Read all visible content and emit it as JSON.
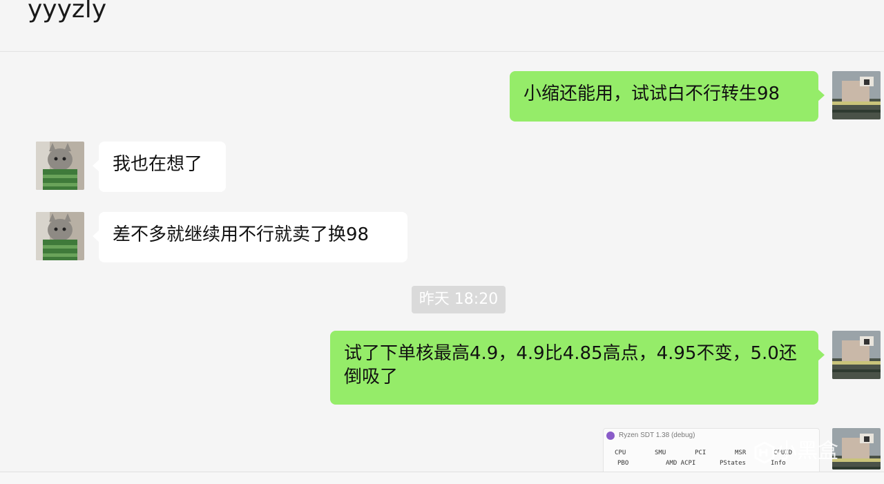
{
  "header": {
    "title": "yyyzly"
  },
  "messages": [
    {
      "side": "out",
      "text": "小缩还能用，试试白不行转生98"
    },
    {
      "side": "in",
      "text": "我也在想了"
    },
    {
      "side": "in",
      "text": "差不多就继续用不行就卖了换98"
    },
    {
      "side": "out",
      "text": "试了下单核最高4.9，4.9比4.85高点，4.95不变，5.0还倒吸了"
    }
  ],
  "timestamp": "昨天 18:20",
  "screenshot_message": {
    "app_title": "Ryzen SDT 1.38 (debug)",
    "tabs_row1": [
      "CPU",
      "SMU",
      "PCI",
      "MSR",
      "CPUID"
    ],
    "tabs_row2": [
      "PBO",
      "AMD ACPI",
      "PStates",
      "Info"
    ]
  },
  "watermark": {
    "text": "小黑盒",
    "icon": "box-logo-icon"
  },
  "colors": {
    "outgoing_bubble": "#95ec69",
    "incoming_bubble": "#ffffff",
    "background": "#f5f5f5"
  }
}
